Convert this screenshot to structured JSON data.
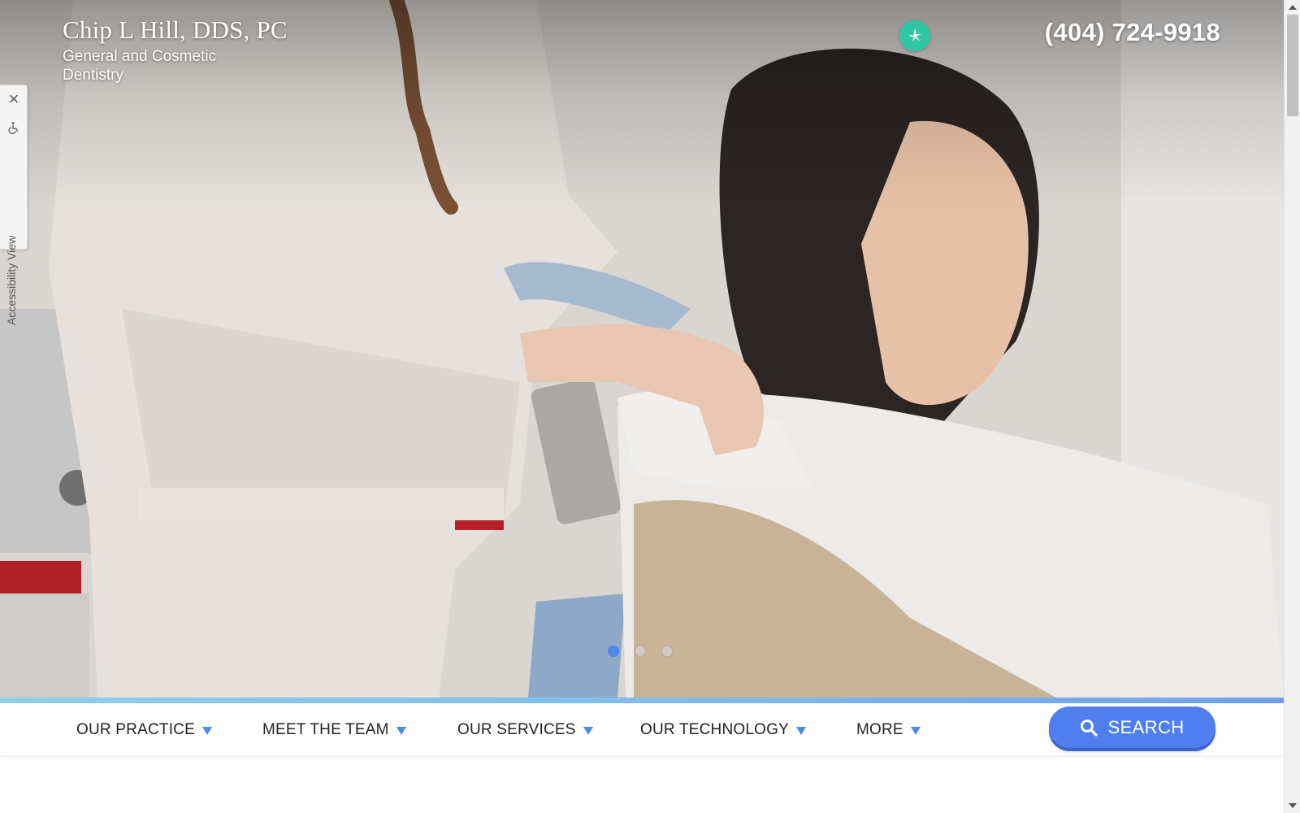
{
  "site": {
    "title": "Chip L Hill, DDS, PC",
    "subtitle": "General and Cosmetic Dentistry",
    "phone": "(404) 724-9918"
  },
  "social": {
    "icon": "yelp-icon",
    "color": "#2fc6a4"
  },
  "accessibility": {
    "label": "Accessibility View"
  },
  "slider": {
    "active": 1,
    "count": 3
  },
  "nav": {
    "items": [
      {
        "label": "OUR PRACTICE"
      },
      {
        "label": "MEET THE TEAM"
      },
      {
        "label": "OUR SERVICES"
      },
      {
        "label": "OUR TECHNOLOGY"
      },
      {
        "label": "MORE"
      }
    ],
    "search_label": "SEARCH"
  },
  "colors": {
    "accent": "#4f86e8",
    "search_button": "#4f7ff0",
    "nav_text": "#222222"
  }
}
